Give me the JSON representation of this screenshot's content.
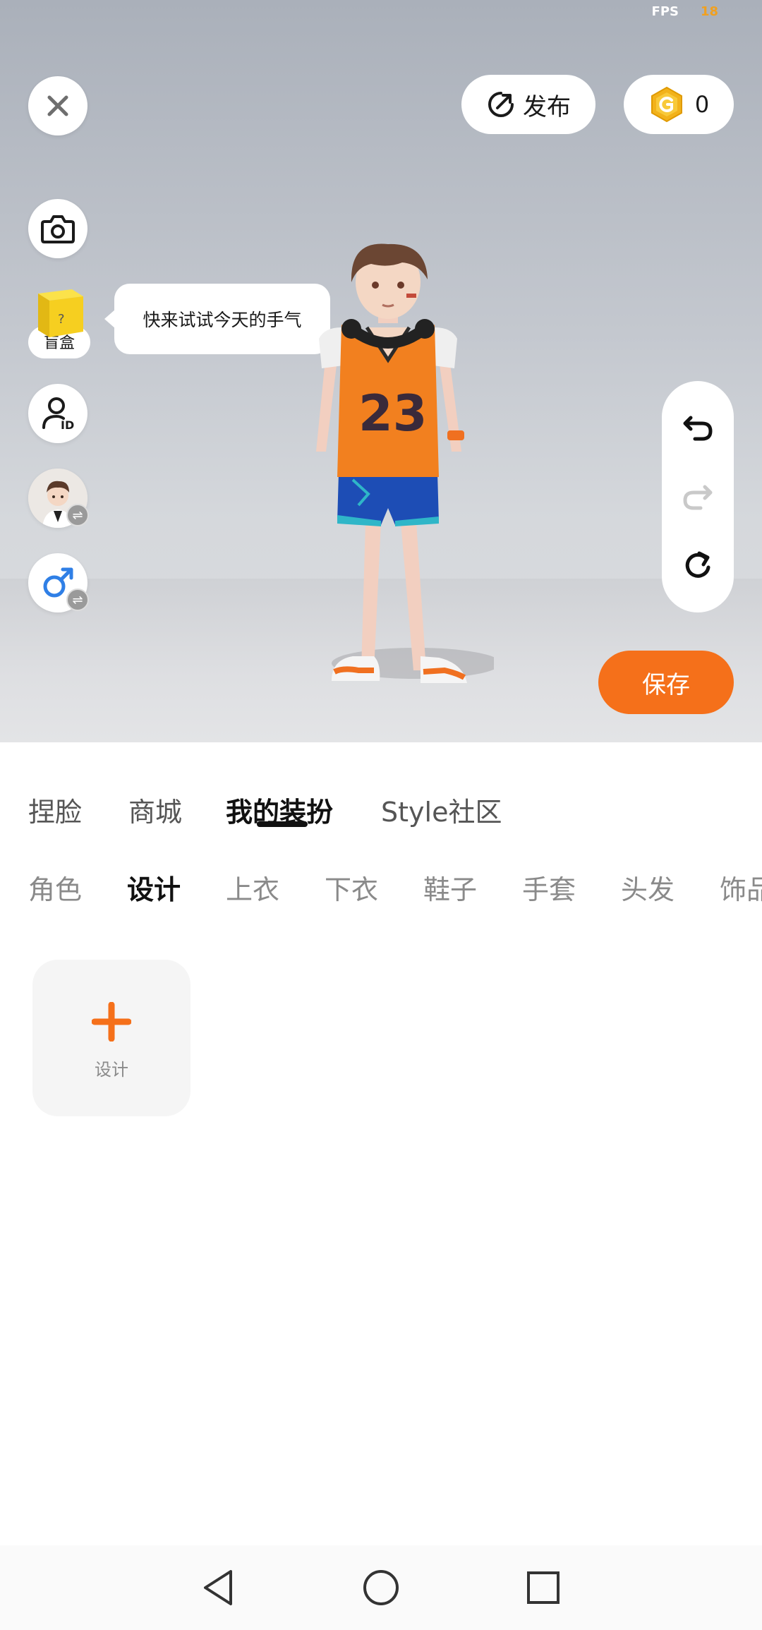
{
  "status": {
    "fps_label": "FPS",
    "fps_value": "18"
  },
  "top_bar": {
    "publish_label": "发布",
    "coin_count": "0"
  },
  "side": {
    "blind_box_label": "盲盒",
    "bubble_text": "快来试试今天的手气"
  },
  "save_label": "保存",
  "main_tabs": [
    {
      "label": "捏脸",
      "active": false
    },
    {
      "label": "商城",
      "active": false
    },
    {
      "label": "我的装扮",
      "active": true
    },
    {
      "label": "Style社区",
      "active": false
    }
  ],
  "sub_tabs": [
    {
      "label": "角色",
      "active": false
    },
    {
      "label": "设计",
      "active": true
    },
    {
      "label": "上衣",
      "active": false
    },
    {
      "label": "下衣",
      "active": false
    },
    {
      "label": "鞋子",
      "active": false
    },
    {
      "label": "手套",
      "active": false
    },
    {
      "label": "头发",
      "active": false
    },
    {
      "label": "饰品",
      "active": false
    }
  ],
  "design_card": {
    "label": "设计"
  },
  "colors": {
    "accent": "#f5701a",
    "coin": "#f2b21b"
  }
}
